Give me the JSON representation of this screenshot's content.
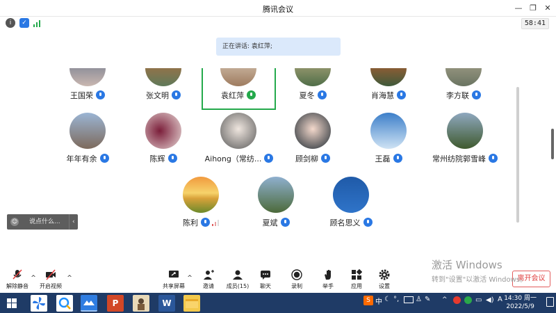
{
  "window": {
    "title": "腾讯会议",
    "minimize": "—",
    "restore": "❐",
    "close": "✕"
  },
  "info": {
    "timer": "58:41"
  },
  "speaking": {
    "label": "正在讲话: 袁红萍;"
  },
  "participants": [
    {
      "name": "王国荣"
    },
    {
      "name": "张文明"
    },
    {
      "name": "袁红萍"
    },
    {
      "name": "夏冬"
    },
    {
      "name": "肖海慧"
    },
    {
      "name": "李方联"
    },
    {
      "name": "年年有余"
    },
    {
      "name": "陈辉"
    },
    {
      "name": "Aihong（常纺..."
    },
    {
      "name": "顾剑柳"
    },
    {
      "name": "王磊"
    },
    {
      "name": "常州纺院郭雪峰"
    },
    {
      "name": "陈利"
    },
    {
      "name": "夏斌"
    },
    {
      "name": "顾名思义"
    }
  ],
  "chat": {
    "placeholder": "说点什么..."
  },
  "toolbar": {
    "unmute": "解除静音",
    "video": "开启视频",
    "share": "共享屏幕",
    "invite": "邀请",
    "members": "成员(15)",
    "chat": "聊天",
    "record": "录制",
    "raise": "举手",
    "apps": "应用",
    "settings": "设置",
    "leave": "离开会议"
  },
  "watermark": {
    "title": "激活 Windows",
    "subtitle": "转到\"设置\"以激活 Windows。"
  },
  "taskbar": {
    "time": "14:30 周一",
    "date": "2022/5/9",
    "ime": "中",
    "ime_mode": "A"
  },
  "colors": {
    "mic": "#2a78e4",
    "speaking_frame": "#23a94b",
    "leave": "#e04040",
    "taskbar": "#1f3b66"
  }
}
